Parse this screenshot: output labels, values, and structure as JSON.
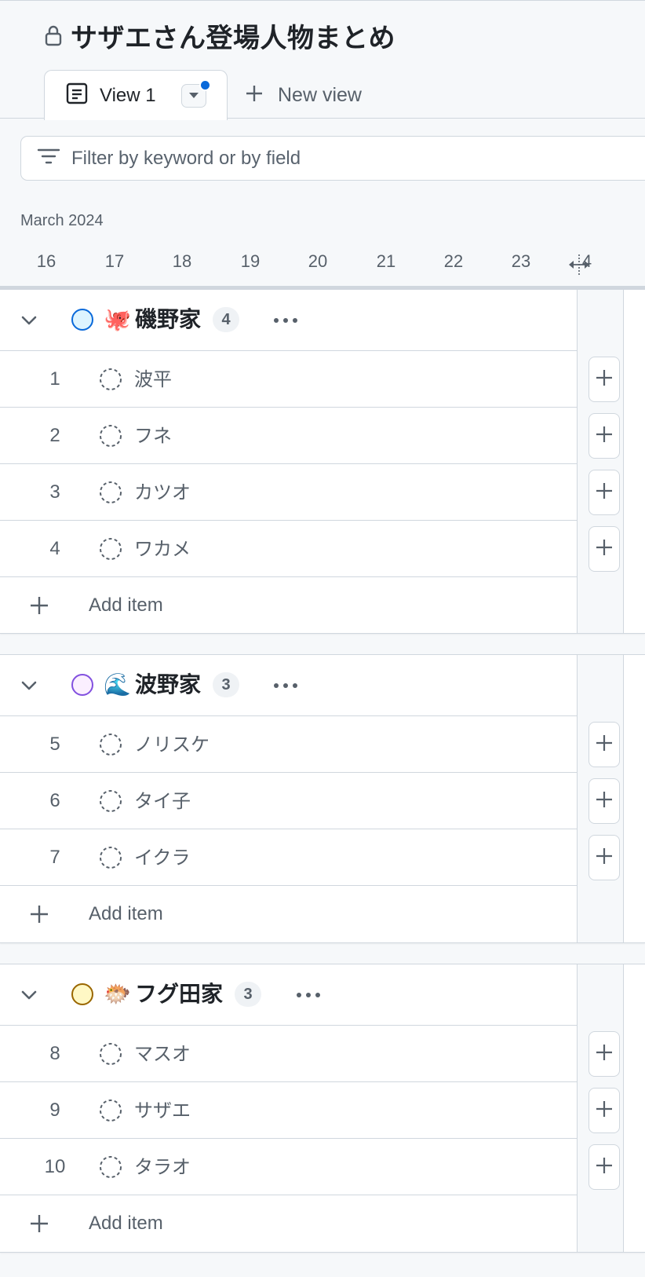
{
  "header": {
    "title": "サザエさん登場人物まとめ",
    "tabs": [
      {
        "label": "View 1",
        "has_unsaved_changes": true
      }
    ],
    "new_view_label": "New view"
  },
  "filter": {
    "placeholder": "Filter by keyword or by field"
  },
  "timeline": {
    "month": "March 2024",
    "days": [
      "16",
      "17",
      "18",
      "19",
      "20",
      "21",
      "22",
      "23",
      "4"
    ]
  },
  "colors": {
    "accent": "#0969da",
    "border": "#d0d7de",
    "muted": "#57606a"
  },
  "groups": [
    {
      "emoji": "🐙",
      "name": "磯野家",
      "count": "4",
      "status_color": "#0969da",
      "status_fill": "#ddf4ff",
      "items": [
        {
          "num": "1",
          "title": "波平"
        },
        {
          "num": "2",
          "title": "フネ"
        },
        {
          "num": "3",
          "title": "カツオ"
        },
        {
          "num": "4",
          "title": "ワカメ"
        }
      ],
      "add_label": "Add item"
    },
    {
      "emoji": "🌊",
      "name": "波野家",
      "count": "3",
      "status_color": "#8250df",
      "status_fill": "#fbefff",
      "items": [
        {
          "num": "5",
          "title": "ノリスケ"
        },
        {
          "num": "6",
          "title": "タイ子"
        },
        {
          "num": "7",
          "title": "イクラ"
        }
      ],
      "add_label": "Add item"
    },
    {
      "emoji": "🐡",
      "name": "フグ田家",
      "count": "3",
      "status_color": "#9a6700",
      "status_fill": "#fff8c5",
      "items": [
        {
          "num": "8",
          "title": "マスオ"
        },
        {
          "num": "9",
          "title": "サザエ"
        },
        {
          "num": "10",
          "title": "タラオ"
        }
      ],
      "add_label": "Add item"
    }
  ]
}
